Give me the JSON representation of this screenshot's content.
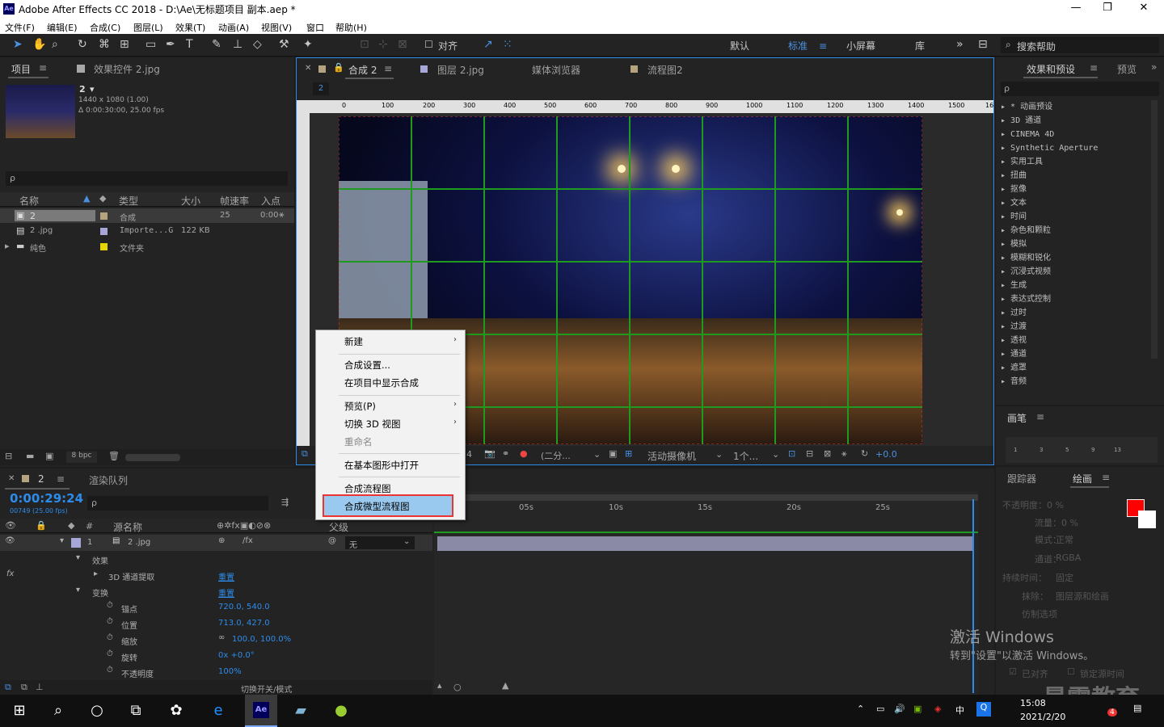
{
  "window": {
    "title": "Adobe After Effects CC 2018 - D:\\Ae\\无标题项目 副本.aep *",
    "logo": "Ae",
    "min": "—",
    "max": "❐",
    "close": "✕"
  },
  "menu": [
    "文件(F)",
    "编辑(E)",
    "合成(C)",
    "图层(L)",
    "效果(T)",
    "动画(A)",
    "视图(V)",
    "窗口",
    "帮助(H)"
  ],
  "toolbar": {
    "snap_label": "对齐",
    "workspaces": [
      "默认",
      "标准",
      "小屏幕",
      "库"
    ],
    "active_workspace": "标准",
    "more": "»",
    "search_placeholder": "搜索帮助"
  },
  "project": {
    "tab": "项目",
    "effects_tab": "效果控件 2.jpg",
    "item_name": "2",
    "item_info1": "1440 x 1080 (1.00)",
    "item_info2": "Δ 0:00:30:00, 25.00 fps",
    "search_placeholder": "ρ",
    "columns": [
      "名称",
      "类型",
      "大小",
      "帧速率",
      "入点"
    ],
    "rows": [
      {
        "name": "2",
        "type": "合成",
        "size": "",
        "fps": "25",
        "in": "0:00"
      },
      {
        "name": "2 .jpg",
        "type": "Importe...G",
        "size": "122 KB",
        "fps": "",
        "in": ""
      },
      {
        "name": "纯色",
        "type": "文件夹",
        "size": "",
        "fps": "",
        "in": ""
      }
    ],
    "bpc": "8 bpc"
  },
  "comp": {
    "tabs": [
      "合成 2",
      "图层 2.jpg",
      "媒体浏览器",
      "流程图2"
    ],
    "breadcrumb": "2",
    "ruler": [
      "0",
      "100",
      "200",
      "300",
      "400",
      "500",
      "600",
      "700",
      "800",
      "900",
      "1000",
      "1100",
      "1200",
      "1300",
      "1400",
      "1500",
      "16"
    ],
    "footer": {
      "timecode": "4",
      "resolution": "(二分...",
      "camera": "活动摄像机",
      "views": "1个...",
      "exposure": "+0.0"
    }
  },
  "context_menu": {
    "items": [
      "新建",
      "合成设置...",
      "在项目中显示合成",
      "预览(P)",
      "切换 3D 视图",
      "重命名",
      "在基本图形中打开",
      "合成流程图",
      "合成微型流程图"
    ],
    "highlighted": "合成微型流程图"
  },
  "effects_panel": {
    "tab": "效果和预设",
    "tab2": "预览",
    "search_placeholder": "ρ",
    "items": [
      "* 动画预设",
      "3D 通道",
      "CINEMA 4D",
      "Synthetic Aperture",
      "实用工具",
      "扭曲",
      "抠像",
      "文本",
      "时间",
      "杂色和颗粒",
      "模拟",
      "模糊和锐化",
      "沉浸式视频",
      "生成",
      "表达式控制",
      "过时",
      "过渡",
      "透视",
      "通道",
      "遮罩",
      "音频"
    ]
  },
  "brush_panel": {
    "tab": "画笔",
    "sizes": [
      "1",
      "3",
      "5",
      "9",
      "13"
    ]
  },
  "paint_panel": {
    "tabs": [
      "跟踪器",
      "绘画"
    ],
    "opacity": "不透明度：0 %",
    "flow": "流量：0 %",
    "mode_label": "模式：",
    "mode": "正常",
    "channel_label": "通道：",
    "channel": "RGBA",
    "duration_label": "持续时间：",
    "duration": "固定",
    "erase_label": "抹除：",
    "erase": "图层源和绘画",
    "clone_label": "仿制选项",
    "align": "已对齐",
    "lock": "锁定源时间"
  },
  "timeline": {
    "tab": "2",
    "render_tab": "渲染队列",
    "timecode": "0:00:29:24",
    "frame": "00749 (25.00 fps)",
    "header": {
      "source": "源名称",
      "parent": "父级"
    },
    "layer": {
      "num": "1",
      "name": "2 .jpg",
      "parent": "无"
    },
    "props": [
      {
        "name": "效果",
        "value": ""
      },
      {
        "name": "3D 通道提取",
        "value": "重置"
      },
      {
        "name": "变换",
        "value": "重置"
      },
      {
        "name": "锚点",
        "value": "720.0, 540.0"
      },
      {
        "name": "位置",
        "value": "713.0, 427.0"
      },
      {
        "name": "缩放",
        "value": "100.0, 100.0%"
      },
      {
        "name": "旋转",
        "value": "0x +0.0°"
      },
      {
        "name": "不透明度",
        "value": "100%"
      }
    ],
    "ruler": [
      "05s",
      "10s",
      "15s",
      "20s",
      "25s"
    ],
    "toggle": "切换开关/模式"
  },
  "watermark": {
    "line1": "激活 Windows",
    "line2": "转到\"设置\"以激活 Windows。",
    "brand": "最需教育"
  },
  "taskbar": {
    "time": "15:08",
    "date": "2021/2/20",
    "ime": "中",
    "badge": "4"
  }
}
